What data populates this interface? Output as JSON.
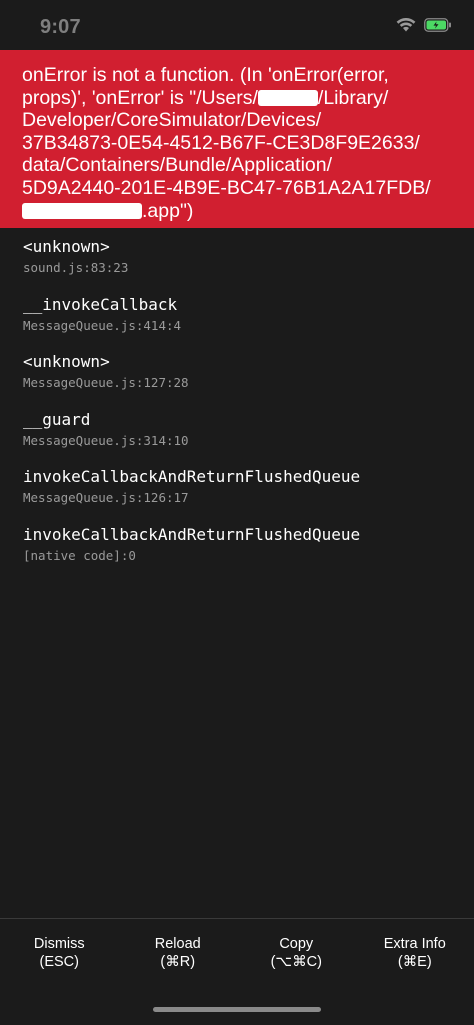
{
  "status_bar": {
    "time": "9:07",
    "battery_color": "#4cd964"
  },
  "error": {
    "line1": "onError is not a function. (In 'onError(error,",
    "line2_a": "props)', 'onError' is \"/Users/",
    "line2_b": "/Library/",
    "line3": "Developer/CoreSimulator/Devices/",
    "line4": "37B34873-0E54-4512-B67F-CE3D8F9E2633/",
    "line5": "data/Containers/Bundle/Application/",
    "line6": "5D9A2440-201E-4B9E-BC47-76B1A2A17FDB/",
    "line7_b": ".app\")",
    "background": "#d11f30"
  },
  "stack": [
    {
      "method": "<unknown>",
      "location": "sound.js:83:23"
    },
    {
      "method": "__invokeCallback",
      "location": "MessageQueue.js:414:4"
    },
    {
      "method": "<unknown>",
      "location": "MessageQueue.js:127:28"
    },
    {
      "method": "__guard",
      "location": "MessageQueue.js:314:10"
    },
    {
      "method": "invokeCallbackAndReturnFlushedQueue",
      "location": "MessageQueue.js:126:17"
    },
    {
      "method": "invokeCallbackAndReturnFlushedQueue",
      "location": "[native code]:0"
    }
  ],
  "toolbar": {
    "dismiss_label": "Dismiss",
    "dismiss_shortcut": "(ESC)",
    "reload_label": "Reload",
    "reload_shortcut": "(⌘R)",
    "copy_label": "Copy",
    "copy_shortcut": "(⌥⌘C)",
    "extra_label": "Extra Info",
    "extra_shortcut": "(⌘E)"
  }
}
